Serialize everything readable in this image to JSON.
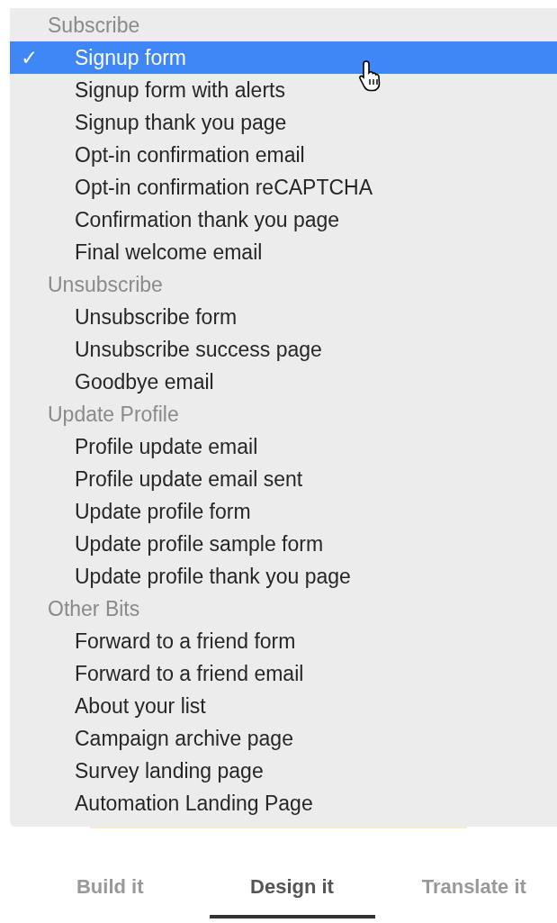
{
  "menu": {
    "groups": [
      {
        "title": "Subscribe",
        "items": [
          {
            "label": "Signup form",
            "selected": true,
            "checked": true
          },
          {
            "label": "Signup form with alerts",
            "selected": false,
            "checked": false
          },
          {
            "label": "Signup thank you page",
            "selected": false,
            "checked": false
          },
          {
            "label": "Opt-in confirmation email",
            "selected": false,
            "checked": false
          },
          {
            "label": "Opt-in confirmation reCAPTCHA",
            "selected": false,
            "checked": false
          },
          {
            "label": "Confirmation thank you page",
            "selected": false,
            "checked": false
          },
          {
            "label": "Final welcome email",
            "selected": false,
            "checked": false
          }
        ]
      },
      {
        "title": "Unsubscribe",
        "items": [
          {
            "label": "Unsubscribe form",
            "selected": false,
            "checked": false
          },
          {
            "label": "Unsubscribe success page",
            "selected": false,
            "checked": false
          },
          {
            "label": "Goodbye email",
            "selected": false,
            "checked": false
          }
        ]
      },
      {
        "title": "Update Profile",
        "items": [
          {
            "label": "Profile update email",
            "selected": false,
            "checked": false
          },
          {
            "label": "Profile update email sent",
            "selected": false,
            "checked": false
          },
          {
            "label": "Update profile form",
            "selected": false,
            "checked": false
          },
          {
            "label": "Update profile sample form",
            "selected": false,
            "checked": false
          },
          {
            "label": "Update profile thank you page",
            "selected": false,
            "checked": false
          }
        ]
      },
      {
        "title": "Other Bits",
        "items": [
          {
            "label": "Forward to a friend form",
            "selected": false,
            "checked": false
          },
          {
            "label": "Forward to a friend email",
            "selected": false,
            "checked": false
          },
          {
            "label": "About your list",
            "selected": false,
            "checked": false
          },
          {
            "label": "Campaign archive page",
            "selected": false,
            "checked": false
          },
          {
            "label": "Survey landing page",
            "selected": false,
            "checked": false
          },
          {
            "label": "Automation Landing Page",
            "selected": false,
            "checked": false
          }
        ]
      }
    ]
  },
  "check_mark": "✓",
  "tabs": [
    {
      "label": "Build it",
      "selected": false
    },
    {
      "label": "Design it",
      "selected": true
    },
    {
      "label": "Translate it",
      "selected": false
    }
  ]
}
